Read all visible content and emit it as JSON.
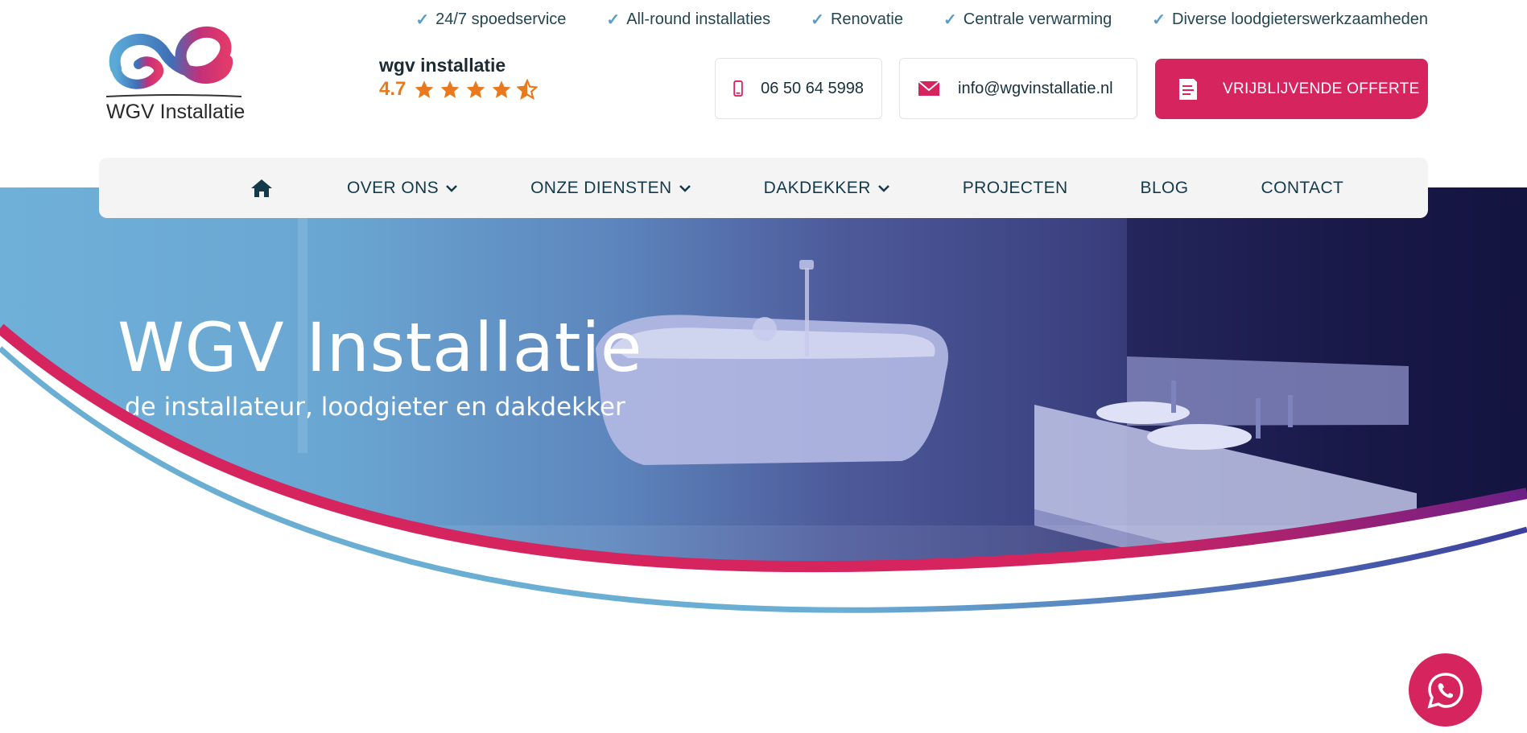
{
  "usp": [
    {
      "label": "24/7 spoedservice"
    },
    {
      "label": "All-round installaties"
    },
    {
      "label": "Renovatie"
    },
    {
      "label": "Centrale verwarming"
    },
    {
      "label": "Diverse loodgieterswerkzaamheden"
    }
  ],
  "logo": {
    "text": "WGV Installatie"
  },
  "review": {
    "name": "wgv installatie",
    "score": "4.7",
    "stars": 4.5
  },
  "contact": {
    "phone": "06 50 64 5998",
    "email": "info@wgvinstallatie.nl"
  },
  "cta": {
    "label": "VRIJBLIJVENDE OFFERTE"
  },
  "nav": {
    "home_icon": "home-icon",
    "items": [
      {
        "label": "OVER ONS"
      },
      {
        "label": "ONZE DIENSTEN"
      },
      {
        "label": "DAKDEKKER"
      },
      {
        "label": "PROJECTEN"
      },
      {
        "label": "BLOG"
      },
      {
        "label": "CONTACT"
      }
    ]
  },
  "hero": {
    "title": "WGV Installatie",
    "subtitle": "de installateur, loodgieter en dakdekker"
  },
  "colors": {
    "brand_pink": "#d6245f",
    "brand_blue": "#6aa6d2",
    "brand_navy": "#143a4a",
    "star_orange": "#e87a1d"
  }
}
